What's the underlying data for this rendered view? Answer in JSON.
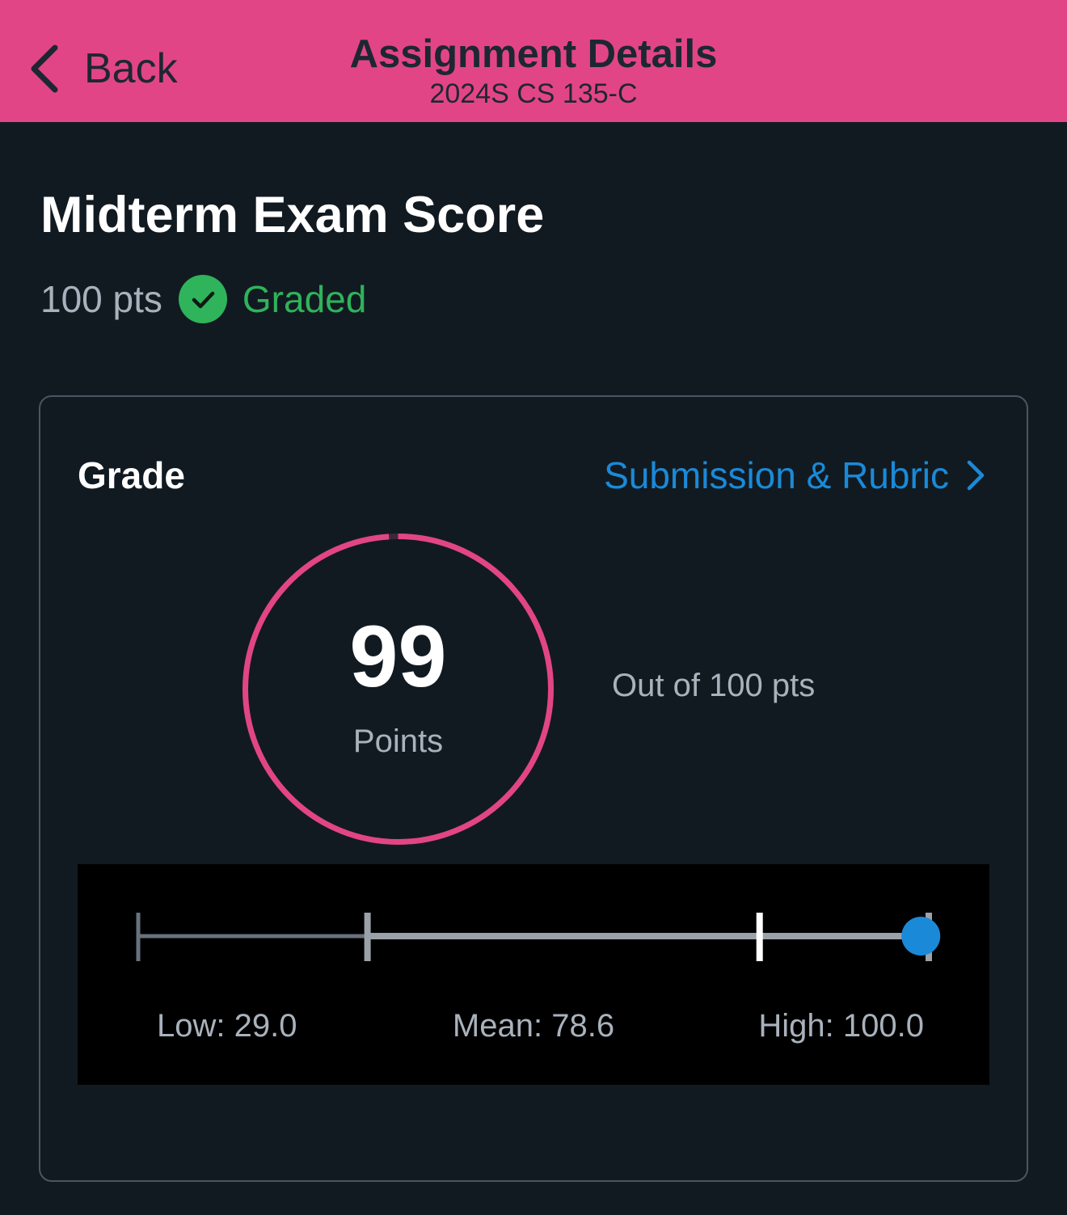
{
  "header": {
    "back_label": "Back",
    "title": "Assignment Details",
    "subtitle": "2024S CS 135-C",
    "background_color": "#e24585"
  },
  "assignment": {
    "title": "Midterm Exam Score",
    "points_label": "100 pts",
    "status_icon": "check-circle-icon",
    "status": "Graded",
    "status_color": "#2fb35b"
  },
  "grade_card": {
    "label": "Grade",
    "link_label": "Submission & Rubric",
    "link_icon": "chevron-right-icon",
    "link_color": "#1a8ad8",
    "score": 99,
    "score_display": "99",
    "max_points": 100,
    "score_unit": "Points",
    "out_of_label": "Out of 100 pts",
    "ring_color": "#e24585",
    "stats": {
      "low": 29.0,
      "mean": 78.6,
      "high": 100.0,
      "your_score": 99,
      "low_label": "Low: 29.0",
      "mean_label": "Mean: 78.6",
      "high_label": "High: 100.0",
      "marker_color": "#1a8ad8"
    }
  }
}
